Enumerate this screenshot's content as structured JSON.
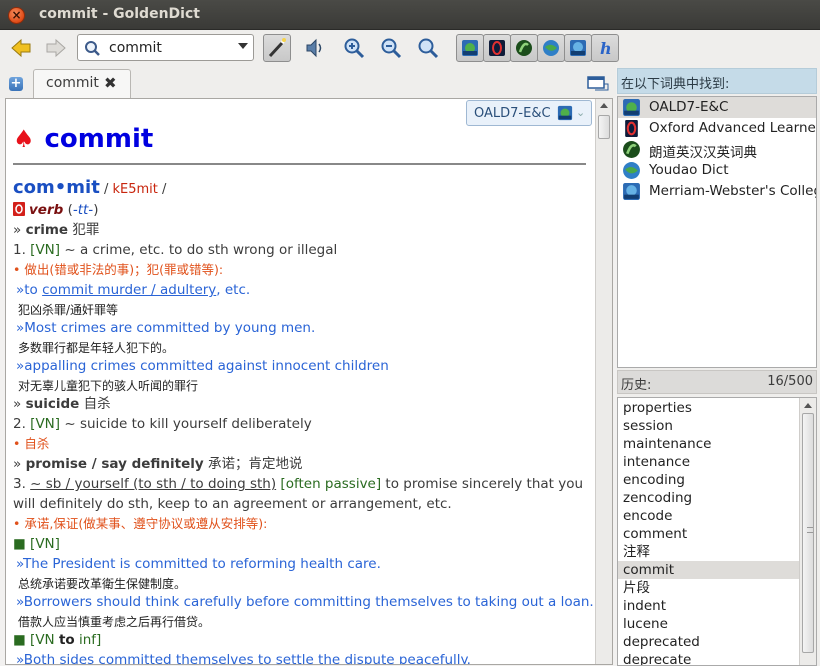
{
  "window": {
    "title": "commit - GoldenDict",
    "close_glyph": "×"
  },
  "toolbar": {
    "search_value": "commit",
    "icons": [
      "back-arrow-icon",
      "forward-arrow-icon",
      "search-icon",
      "magic-wand-icon",
      "speaker-icon",
      "zoom-in-icon",
      "zoom-out-icon",
      "zoom-reset-icon",
      "oald-dict-icon",
      "oxford-dict-icon",
      "langdao-dict-icon",
      "youdao-dict-icon",
      "merriam-dict-icon",
      "h-icon"
    ]
  },
  "tabs": [
    {
      "label": "commit",
      "close_glyph": "✖"
    }
  ],
  "new_tab_glyph": "+",
  "article": {
    "dict_badge": "OALD7-E&C",
    "headword": "commit",
    "spade": "♠",
    "pron_word": "com•mit",
    "pron_sep1": " / ",
    "pron": "kE5mit",
    "pron_sep2": " /",
    "pos": "verb",
    "pos_extra_open": " (",
    "pos_extra": "-tt-",
    "pos_extra_close": ")",
    "lines": {
      "l1_arrow": "» ",
      "l1_word": "crime",
      "l1_cn": " 犯罪",
      "l2_num": "1. ",
      "l2_vn": "[VN]",
      "l2_def": " ~ a crime, etc. to do sth wrong or illegal",
      "l3": "• 做出(错或非法的事)；犯(罪或错等):",
      "l4_pre": "»to ",
      "l4_link": "commit murder / adultery",
      "l4_post": ", etc.",
      "l5": "犯凶杀罪/通奸罪等",
      "l6": "»Most crimes are committed by young men.",
      "l7": "多数罪行都是年轻人犯下的。",
      "l8": "»appalling crimes committed against innocent children",
      "l9": "对无辜儿童犯下的骇人听闻的罪行",
      "l10_arrow": "» ",
      "l10_word": "suicide",
      "l10_cn": " 自杀",
      "l11_num": "2. ",
      "l11_vn": "[VN]",
      "l11_def": " ~ suicide to kill yourself deliberately",
      "l12": "• 自杀",
      "l13_arrow": "» ",
      "l13_word": "promise / say definitely",
      "l13_cn": " 承诺；肯定地说",
      "l14_num": "3. ",
      "l14_link": "~ sb / yourself (to sth / to doing sth)",
      "l14_sp": " ",
      "l14_tag": "[often passive]",
      "l14_def": " to promise sincerely that you",
      "l15": "will definitely do sth, keep to an agreement or arrangement, etc.",
      "l16": "• 承诺,保证(做某事、遵守协议或遵从安排等):",
      "l17": "■ [VN]",
      "l18": "»The President is committed to reforming health care.",
      "l19": "总统承诺要改革衛生保健制度。",
      "l20": "»Borrowers should think carefully before committing themselves to taking out a loan.",
      "l21": "借款人应当慎重考虑之后再行借贷。",
      "l22_a": "■ [VN ",
      "l22_b": "to",
      "l22_c": " inf]",
      "l23": "»Both sides committed themselves to settle the dispute peacefully."
    }
  },
  "found_panel": {
    "header": "在以下词典中找到:",
    "items": [
      "OALD7-E&C",
      "Oxford Advanced Learner's",
      "朗道英汉汉英词典",
      "Youdao Dict",
      "Merriam-Webster's Collegiate"
    ]
  },
  "history": {
    "header": "历史:",
    "count": "16/500",
    "items": [
      "properties",
      "session",
      "maintenance",
      "intenance",
      "encoding",
      "zencoding",
      "encode",
      "comment",
      "注释",
      "commit",
      "片段",
      "indent",
      "lucene",
      "deprecated",
      "deprecate"
    ],
    "selected": "commit"
  }
}
